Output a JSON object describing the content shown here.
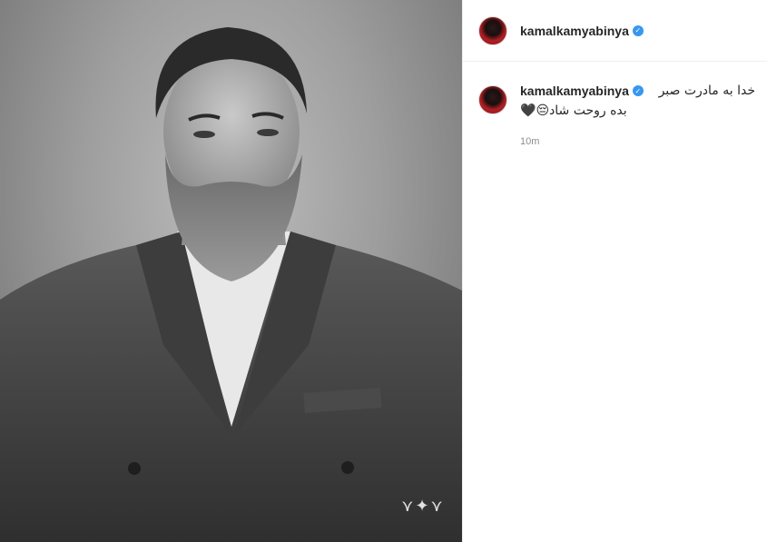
{
  "post": {
    "username": "kamalkamyabinya",
    "verified_icon": "verified-badge-icon",
    "accent_color": "#3897f0"
  },
  "comment": {
    "username": "kamalkamyabinya",
    "caption_line1": "خدا به مادرت صبر",
    "caption_line2": "بده روحت شاد",
    "emoji_sad": "😔",
    "emoji_heart": "🖤",
    "time": "10m"
  },
  "watermark": {
    "icon": "eagle-logo-icon"
  }
}
